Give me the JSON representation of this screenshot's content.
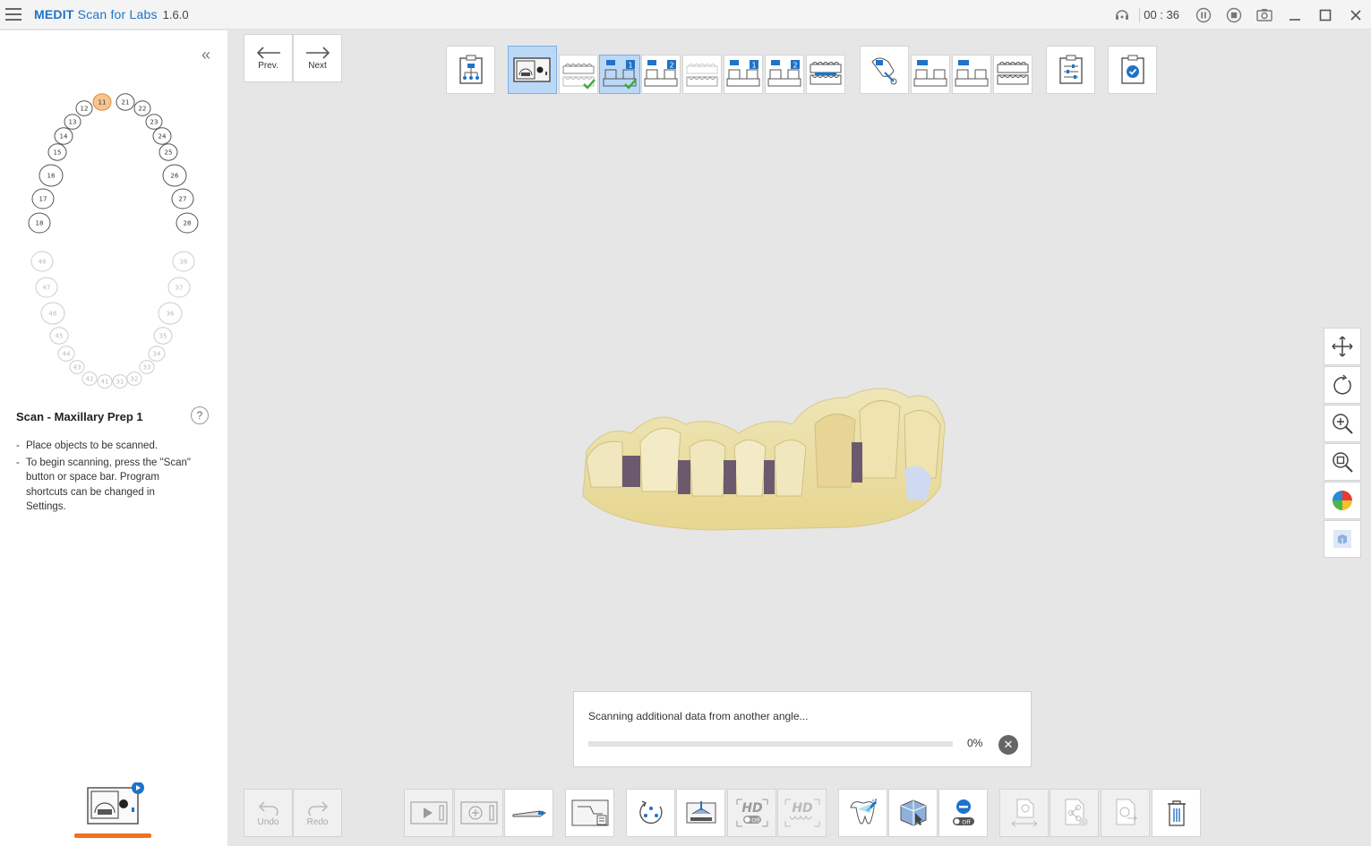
{
  "app": {
    "name_bold": "MEDIT",
    "name_rest": " Scan for Labs",
    "version": "1.6.0",
    "timer": "00 : 36"
  },
  "titlebar_icons": [
    "remote-support-icon",
    "pause-icon",
    "stop-icon",
    "screenshot-icon",
    "minimize-icon",
    "maximize-icon",
    "close-icon"
  ],
  "nav": {
    "prev_label": "Prev.",
    "next_label": "Next"
  },
  "tooth_chart": {
    "upper_teeth": [
      "11",
      "21",
      "12",
      "22",
      "13",
      "23",
      "14",
      "24",
      "15",
      "25",
      "16",
      "26",
      "17",
      "27",
      "18",
      "28"
    ],
    "lower_teeth": [
      "48",
      "38",
      "47",
      "37",
      "46",
      "36",
      "45",
      "35",
      "44",
      "34",
      "43",
      "33",
      "42",
      "32",
      "41",
      "31"
    ],
    "selected": "11",
    "colors": {
      "selected_fill": "#f7c48f",
      "selected_stroke": "#d98c3a",
      "upper_stroke": "#555555",
      "lower_stroke": "#cccccc"
    }
  },
  "step": {
    "title": "Scan - Maxillary Prep 1",
    "help": "?",
    "instructions": [
      "Place objects to be scanned.",
      "To begin scanning, press the \"Scan\" button or space bar. Program shortcuts can be changed in Settings."
    ]
  },
  "undo_redo": {
    "undo": "Undo",
    "redo": "Redo"
  },
  "progress": {
    "message": "Scanning additional data from another angle...",
    "percent_text": "0%",
    "percent_value": 0,
    "cancel": "✕"
  },
  "hd_label": "HD",
  "off_label": "Off",
  "step_badges": {
    "one": "1",
    "two": "2"
  },
  "colors": {
    "accent": "#1f73c8",
    "active_bg": "#bcd8f7",
    "progress_bar": "#f37021",
    "check": "#3aaa35"
  }
}
